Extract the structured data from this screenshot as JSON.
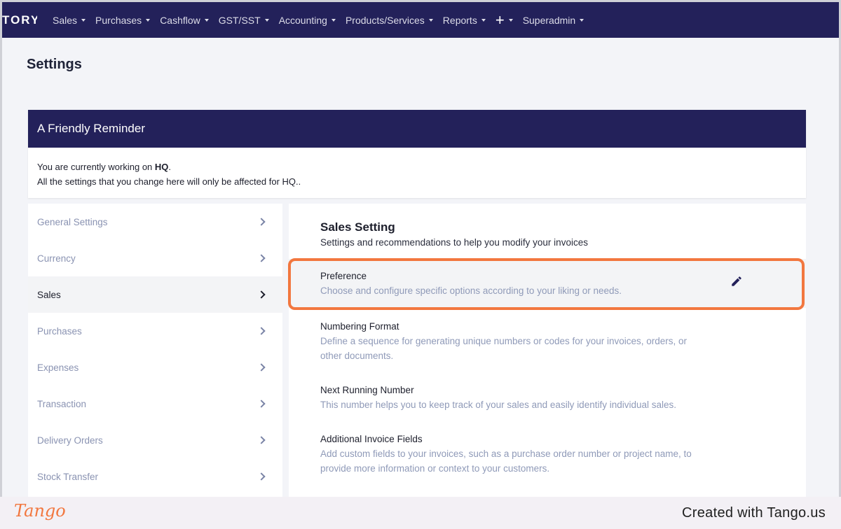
{
  "navbar": {
    "brand": "TORY",
    "items": [
      {
        "label": "Sales"
      },
      {
        "label": "Purchases"
      },
      {
        "label": "Cashflow"
      },
      {
        "label": "GST/SST"
      },
      {
        "label": "Accounting"
      },
      {
        "label": "Products/Services"
      },
      {
        "label": "Reports"
      },
      {
        "label": "+"
      },
      {
        "label": "Superadmin"
      }
    ]
  },
  "page": {
    "title": "Settings"
  },
  "reminder": {
    "title": "A Friendly Reminder",
    "line1_prefix": "You are currently working on ",
    "line1_branch": "HQ",
    "line1_suffix": ".",
    "line2": "All the settings that you change here will only be affected for HQ.."
  },
  "side_menu": {
    "items": [
      {
        "label": "General Settings"
      },
      {
        "label": "Currency"
      },
      {
        "label": "Sales"
      },
      {
        "label": "Purchases"
      },
      {
        "label": "Expenses"
      },
      {
        "label": "Transaction"
      },
      {
        "label": "Delivery Orders"
      },
      {
        "label": "Stock Transfer"
      }
    ],
    "active_item": "Sales"
  },
  "panel": {
    "title": "Sales Setting",
    "subtitle": "Settings and recommendations to help you modify your invoices",
    "settings": [
      {
        "title": "Preference",
        "desc": "Choose and configure specific options according to your liking or needs."
      },
      {
        "title": "Numbering Format",
        "desc": "Define a sequence for generating unique numbers or codes for your invoices, orders, or other documents."
      },
      {
        "title": "Next Running Number",
        "desc": "This number helps you to keep track of your sales and easily identify individual sales."
      },
      {
        "title": "Additional Invoice Fields",
        "desc": "Add custom fields to your invoices, such as a purchase order number or project name, to provide more information or context to your customers."
      }
    ]
  },
  "footer": {
    "logo": "Tango",
    "credit": "Created with Tango.us"
  },
  "colors": {
    "nav_bg": "#23215a",
    "highlight": "#f2773f",
    "muted_text": "#8f9ab8"
  }
}
